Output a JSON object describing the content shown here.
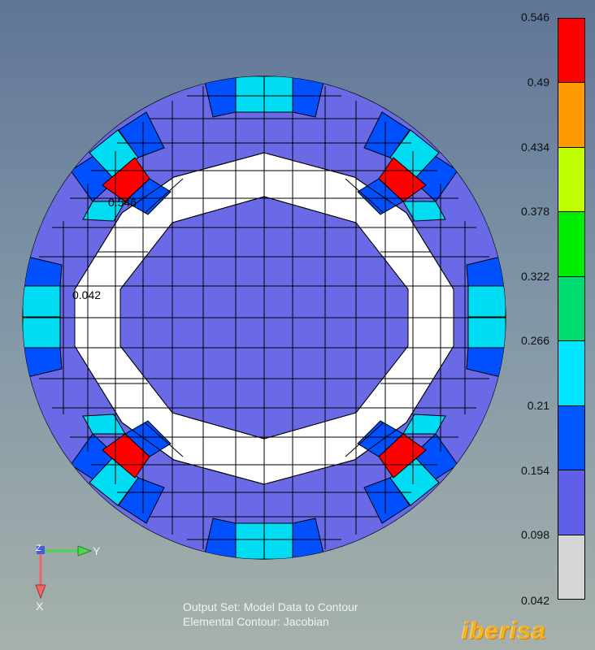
{
  "legend": {
    "values": [
      "0.546",
      "0.49",
      "0.434",
      "0.378",
      "0.322",
      "0.266",
      "0.21",
      "0.154",
      "0.098",
      "0.042"
    ],
    "colors": [
      "#ff0000",
      "#ff9900",
      "#bfff00",
      "#00ee00",
      "#00dd70",
      "#00e5ff",
      "#0057ff",
      "#5f5fe8",
      "#d6d6d6"
    ]
  },
  "annotations": {
    "max_label": "0.546",
    "min_label": "0.042"
  },
  "triad": {
    "z_label": "Z",
    "y_label": "Y",
    "x_label": "X"
  },
  "footer": {
    "line1": "Output Set: Model Data to Contour",
    "line2": "Elemental Contour: Jacobian"
  },
  "brand": {
    "text": "iberisa"
  }
}
